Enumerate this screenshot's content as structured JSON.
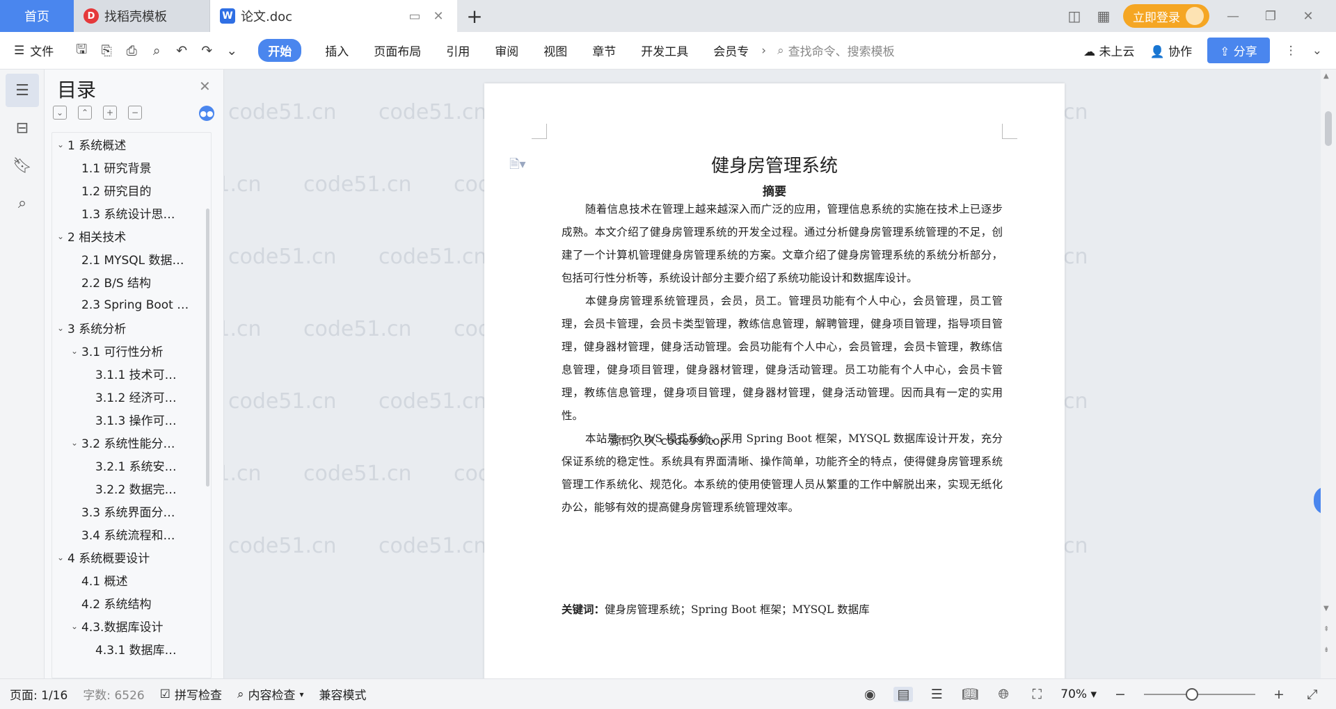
{
  "titlebar": {
    "home_tab": "首页",
    "tabs": [
      {
        "label": "找稻壳模板",
        "icon": "daoke-logo-icon"
      },
      {
        "label": "论文.doc",
        "icon": "wps-writer-icon"
      }
    ],
    "login_label": "立即登录"
  },
  "toolbar": {
    "file_label": "文件",
    "menus": [
      "开始",
      "插入",
      "页面布局",
      "引用",
      "审阅",
      "视图",
      "章节",
      "开发工具",
      "会员专"
    ],
    "search_placeholder": "查找命令、搜索模板",
    "cloud_label": "未上云",
    "collab_label": "协作",
    "share_label": "分享"
  },
  "toc": {
    "title": "目录",
    "items": [
      {
        "level": 0,
        "expanded": true,
        "text": "1 系统概述"
      },
      {
        "level": 1,
        "expanded": null,
        "text": "1.1  研究背景"
      },
      {
        "level": 1,
        "expanded": null,
        "text": "1.2 研究目的"
      },
      {
        "level": 1,
        "expanded": null,
        "text": "1.3 系统设计思…"
      },
      {
        "level": 0,
        "expanded": true,
        "text": "2 相关技术"
      },
      {
        "level": 1,
        "expanded": null,
        "text": "2.1 MYSQL 数据…"
      },
      {
        "level": 1,
        "expanded": null,
        "text": "2.2 B/S 结构"
      },
      {
        "level": 1,
        "expanded": null,
        "text": "2.3 Spring Boot …"
      },
      {
        "level": 0,
        "expanded": true,
        "text": "3 系统分析"
      },
      {
        "level": 1,
        "expanded": true,
        "text": "3.1 可行性分析"
      },
      {
        "level": 2,
        "expanded": null,
        "text": "3.1.1 技术可…"
      },
      {
        "level": 2,
        "expanded": null,
        "text": "3.1.2 经济可…"
      },
      {
        "level": 2,
        "expanded": null,
        "text": "3.1.3 操作可…"
      },
      {
        "level": 1,
        "expanded": true,
        "text": "3.2 系统性能分…"
      },
      {
        "level": 2,
        "expanded": null,
        "text": "3.2.1  系统安…"
      },
      {
        "level": 2,
        "expanded": null,
        "text": "3.2.2  数据完…"
      },
      {
        "level": 1,
        "expanded": null,
        "text": "3.3 系统界面分…"
      },
      {
        "level": 1,
        "expanded": null,
        "text": "3.4 系统流程和…"
      },
      {
        "level": 0,
        "expanded": true,
        "text": "4 系统概要设计"
      },
      {
        "level": 1,
        "expanded": null,
        "text": "4.1 概述"
      },
      {
        "level": 1,
        "expanded": null,
        "text": "4.2 系统结构"
      },
      {
        "level": 1,
        "expanded": true,
        "text": "4.3.数据库设计"
      },
      {
        "level": 2,
        "expanded": null,
        "text": "4.3.1 数据库…"
      }
    ]
  },
  "document": {
    "title": "健身房管理系统",
    "subtitle": "摘要",
    "paragraphs": [
      "随着信息技术在管理上越来越深入而广泛的应用，管理信息系统的实施在技术上已逐步成熟。本文介绍了健身房管理系统的开发全过程。通过分析健身房管理系统管理的不足，创建了一个计算机管理健身房管理系统的方案。文章介绍了健身房管理系统的系统分析部分，包括可行性分析等，系统设计部分主要介绍了系统功能设计和数据库设计。",
      "本健身房管理系统管理员，会员，员工。管理员功能有个人中心，会员管理，员工管理，会员卡管理，会员卡类型管理，教练信息管理，解聘管理，健身项目管理，指导项目管理，健身器材管理，健身活动管理。会员功能有个人中心，会员管理，会员卡管理，教练信息管理，健身项目管理，健身器材管理，健身活动管理。员工功能有个人中心，会员卡管理，教练信息管理，健身项目管理，健身器材管理，健身活动管理。因而具有一定的实用性。",
      "本站是一个 B/S 模式系统，采用 Spring Boot 框架，MYSQL 数据库设计开发，充分保证系统的稳定性。系统具有界面清晰、操作简单，功能齐全的特点，使得健身房管理系统管理工作系统化、规范化。本系统的使用使管理人员从繁重的工作中解脱出来，实现无纸化办公，能够有效的提高健身房管理系统管理效率。"
    ],
    "keywords_label": "关键词：",
    "keywords": "健身房管理系统；Spring Boot 框架；MYSQL 数据库",
    "overlay_watermark": "源码久久 code99.top",
    "watermark_text": "code51.cn"
  },
  "statusbar": {
    "page": "页面: 1/16",
    "words": "字数: 6526",
    "spell_check": "拼写检查",
    "content_check": "内容检查",
    "compat_mode": "兼容模式",
    "zoom": "70%",
    "zoom_fraction": 0.7
  },
  "colors": {
    "accent": "#4a86ee",
    "login": "#f5a623"
  }
}
